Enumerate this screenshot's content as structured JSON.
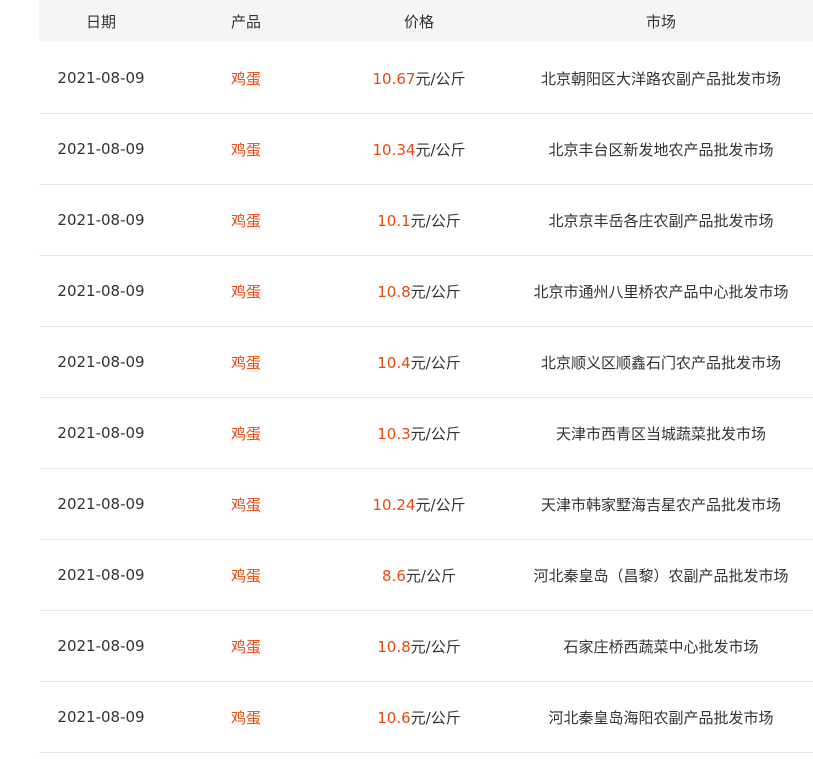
{
  "columns": {
    "date": "日期",
    "product": "产品",
    "price": "价格",
    "market": "市场"
  },
  "rows": [
    {
      "date": "2021-08-09",
      "product": "鸡蛋",
      "price": "10.67",
      "unit": "元/公斤",
      "market": "北京朝阳区大洋路农副产品批发市场"
    },
    {
      "date": "2021-08-09",
      "product": "鸡蛋",
      "price": "10.34",
      "unit": "元/公斤",
      "market": "北京丰台区新发地农产品批发市场"
    },
    {
      "date": "2021-08-09",
      "product": "鸡蛋",
      "price": "10.1",
      "unit": "元/公斤",
      "market": "北京京丰岳各庄农副产品批发市场"
    },
    {
      "date": "2021-08-09",
      "product": "鸡蛋",
      "price": "10.8",
      "unit": "元/公斤",
      "market": "北京市通州八里桥农产品中心批发市场"
    },
    {
      "date": "2021-08-09",
      "product": "鸡蛋",
      "price": "10.4",
      "unit": "元/公斤",
      "market": "北京顺义区顺鑫石门农产品批发市场"
    },
    {
      "date": "2021-08-09",
      "product": "鸡蛋",
      "price": "10.3",
      "unit": "元/公斤",
      "market": "天津市西青区当城蔬菜批发市场"
    },
    {
      "date": "2021-08-09",
      "product": "鸡蛋",
      "price": "10.24",
      "unit": "元/公斤",
      "market": "天津市韩家墅海吉星农产品批发市场"
    },
    {
      "date": "2021-08-09",
      "product": "鸡蛋",
      "price": "8.6",
      "unit": "元/公斤",
      "market": "河北秦皇岛（昌黎）农副产品批发市场"
    },
    {
      "date": "2021-08-09",
      "product": "鸡蛋",
      "price": "10.8",
      "unit": "元/公斤",
      "market": "石家庄桥西蔬菜中心批发市场"
    },
    {
      "date": "2021-08-09",
      "product": "鸡蛋",
      "price": "10.6",
      "unit": "元/公斤",
      "market": "河北秦皇岛海阳农副产品批发市场"
    }
  ],
  "colors": {
    "accent": "#e8490f",
    "text": "#333333",
    "header_bg": "#f5f5f5",
    "divider": "#e6e6e6"
  }
}
